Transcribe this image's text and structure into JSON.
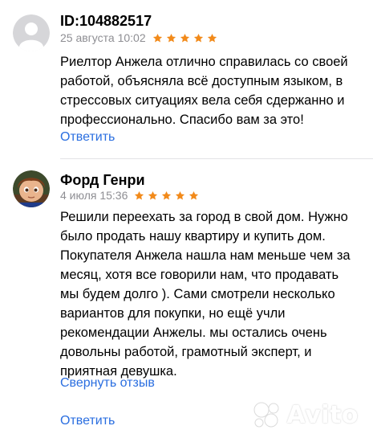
{
  "colors": {
    "link": "#2a6ee0",
    "star": "#f28a1a",
    "date": "#8e8e93",
    "divider": "#e3e3e6"
  },
  "reviews": [
    {
      "author": "ID:104882517",
      "date": "25 августа 10:02",
      "rating": 5,
      "avatar_icon": "default-user-avatar-icon",
      "text_lines": [
        "Риелтор Анжела отлично справилась со своей",
        "работой, объясняла всё доступным языком, в",
        "стрессовых ситуациях вела себя сдержанно и",
        "профессионально. Спасибо вам за это!"
      ],
      "reply_label": "Ответить"
    },
    {
      "author": "Форд Генри",
      "date": "4 июля 15:36",
      "rating": 5,
      "avatar_icon": "photo-avatar-icon",
      "text_lines": [
        "Решили переехать за город в свой дом. Нужно",
        "было продать нашу квартиру и купить дом.",
        "Покупателя Анжела нашла нам  меньше чем за",
        "месяц, хотя все говорили нам, что продавать",
        "мы будем долго ). Сами смотрели несколько",
        "вариантов для покупки, но ещё  учли",
        "рекомендации Анжелы. мы остались очень",
        "довольны работой, грамотный эксперт, и",
        "приятная девушка."
      ],
      "collapse_label": "Свернуть отзыв",
      "reply_label": "Ответить"
    }
  ],
  "watermark": {
    "text": "Avito",
    "icon": "avito-logo-icon"
  }
}
